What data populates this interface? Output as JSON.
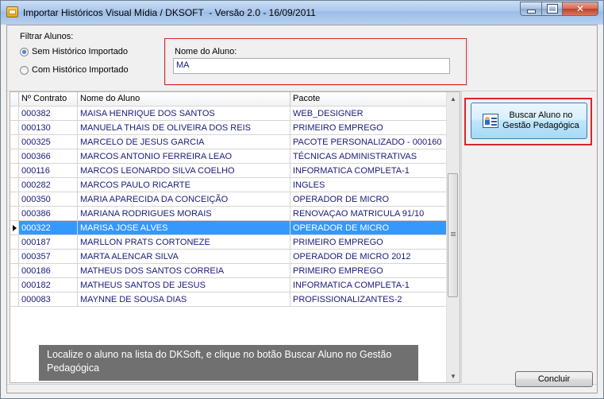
{
  "window": {
    "title": "Importar Históricos Visual Mídia / DKSOFT  - Versão 2.0 - 16/09/2011"
  },
  "filter": {
    "group_title": "Filtrar Alunos:",
    "options": [
      {
        "label": "Sem Histórico Importado",
        "checked": true
      },
      {
        "label": "Com Histórico Importado",
        "checked": false
      }
    ]
  },
  "search": {
    "label": "Nome do Aluno:",
    "value": "MA"
  },
  "grid": {
    "columns": [
      "Nº Contrato",
      "Nome do Aluno",
      "Pacote"
    ],
    "rows": [
      {
        "contrato": "000382",
        "nome": "MAISA HENRIQUE DOS SANTOS",
        "pacote": "WEB_DESIGNER",
        "selected": false
      },
      {
        "contrato": "000130",
        "nome": "MANUELA THAIS DE OLIVEIRA DOS REIS",
        "pacote": "PRIMEIRO EMPREGO",
        "selected": false
      },
      {
        "contrato": "000325",
        "nome": "MARCELO DE JESUS GARCIA",
        "pacote": "PACOTE PERSONALIZADO - 000160",
        "selected": false
      },
      {
        "contrato": "000366",
        "nome": "MARCOS ANTONIO FERREIRA LEAO",
        "pacote": "TÉCNICAS ADMINISTRATIVAS",
        "selected": false
      },
      {
        "contrato": "000116",
        "nome": "MARCOS LEONARDO SILVA COELHO",
        "pacote": "INFORMATICA COMPLETA-1",
        "selected": false
      },
      {
        "contrato": "000282",
        "nome": "MARCOS PAULO RICARTE",
        "pacote": "INGLES",
        "selected": false
      },
      {
        "contrato": "000350",
        "nome": "MARIA APARECIDA DA CONCEIÇÃO",
        "pacote": "OPERADOR DE MICRO",
        "selected": false
      },
      {
        "contrato": "000386",
        "nome": "MARIANA RODRIGUES MORAIS",
        "pacote": "RENOVAÇAO MATRICULA 91/10",
        "selected": false
      },
      {
        "contrato": "000322",
        "nome": "MARISA JOSE ALVES",
        "pacote": "OPERADOR DE MICRO",
        "selected": true
      },
      {
        "contrato": "000187",
        "nome": "MARLLON PRATS CORTONEZE",
        "pacote": "PRIMEIRO EMPREGO",
        "selected": false
      },
      {
        "contrato": "000357",
        "nome": "MARTA ALENCAR SILVA",
        "pacote": "OPERADOR DE MICRO 2012",
        "selected": false
      },
      {
        "contrato": "000186",
        "nome": "MATHEUS DOS SANTOS CORREIA",
        "pacote": "PRIMEIRO EMPREGO",
        "selected": false
      },
      {
        "contrato": "000182",
        "nome": "MATHEUS SANTOS DE JESUS",
        "pacote": "INFORMATICA COMPLETA-1",
        "selected": false
      },
      {
        "contrato": "000083",
        "nome": "MAYNNE DE SOUSA DIAS",
        "pacote": "PROFISSIONALIZANTES-2",
        "selected": false
      }
    ]
  },
  "actions": {
    "buscar_label": "Buscar Aluno no Gestão Pedagógica",
    "concluir_label": "Concluir"
  },
  "tooltip": {
    "text": "Localize o aluno na lista do DKSoft, e clique no botão Buscar Aluno no Gestão Pedagógica"
  },
  "colors": {
    "selection": "#3399ff",
    "highlight_border": "#d8262b",
    "cell_text": "#1a1a7a"
  }
}
